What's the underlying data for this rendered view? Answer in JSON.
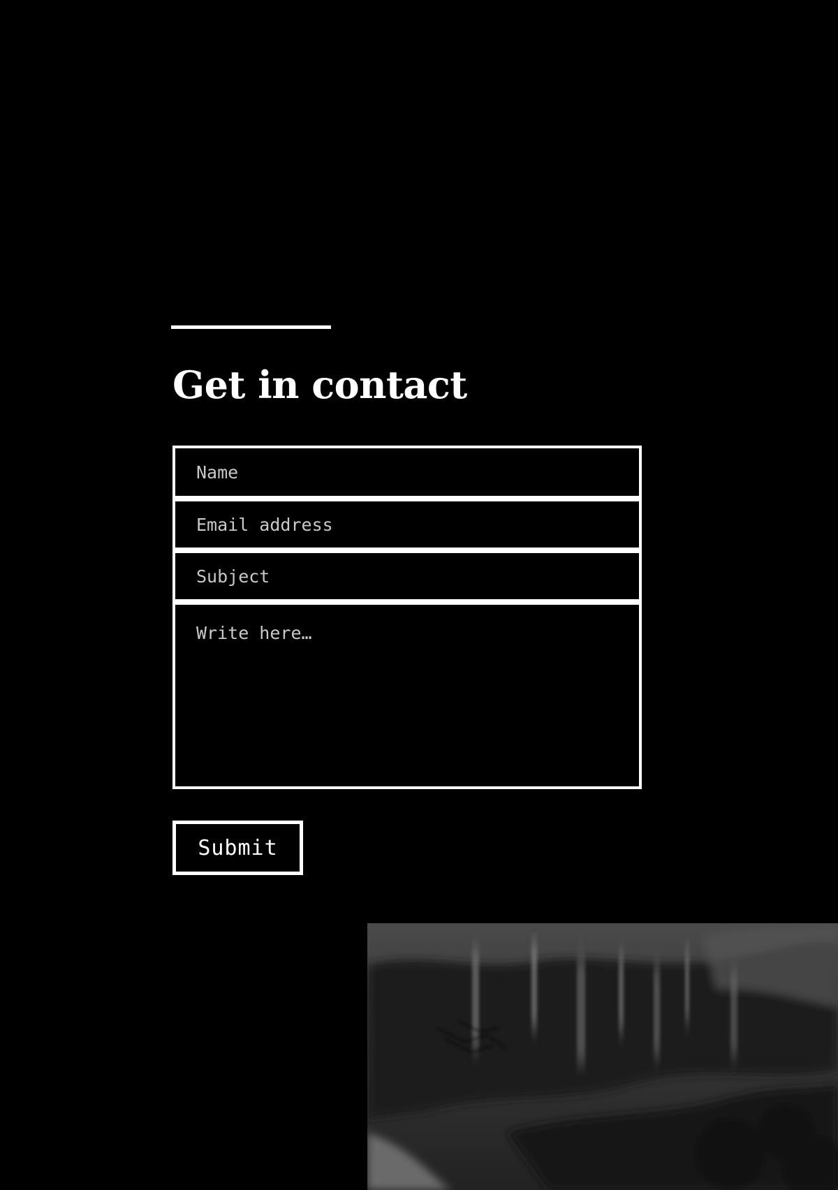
{
  "section": {
    "title": "Get in contact"
  },
  "form": {
    "name_placeholder": "Name",
    "email_placeholder": "Email address",
    "subject_placeholder": "Subject",
    "message_placeholder": "Write here…",
    "submit_label": "Submit"
  },
  "colors": {
    "background": "#000000",
    "foreground": "#ffffff",
    "placeholder": "#c9c9c9"
  },
  "image": {
    "description_icon": "blurred-forest-photo"
  }
}
